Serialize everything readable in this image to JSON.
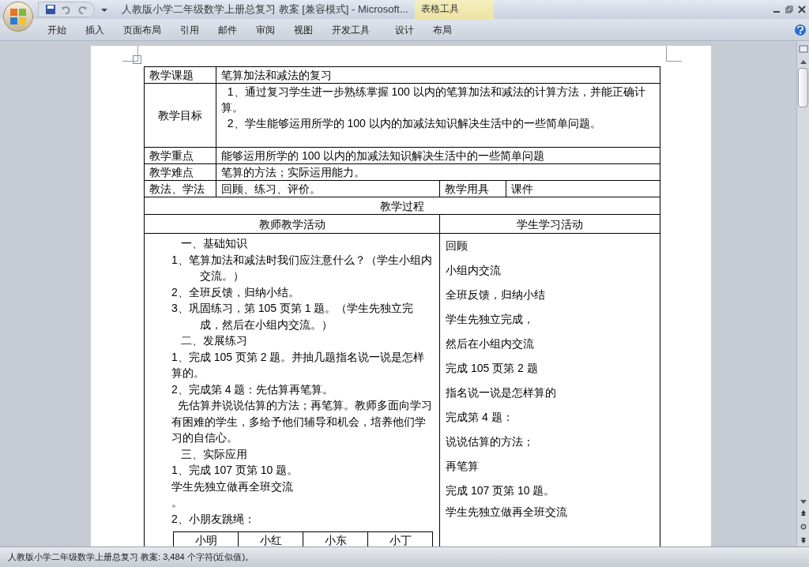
{
  "window": {
    "title": "人教版小学二年级数学上册总复习 教案 [兼容模式] - Microsoft...",
    "context_tab": "表格工具"
  },
  "ribbon_tabs": [
    {
      "label": "开始",
      "selected": false
    },
    {
      "label": "插入",
      "selected": false
    },
    {
      "label": "页面布局",
      "selected": false
    },
    {
      "label": "引用",
      "selected": false
    },
    {
      "label": "邮件",
      "selected": false
    },
    {
      "label": "审阅",
      "selected": false
    },
    {
      "label": "视图",
      "selected": false
    },
    {
      "label": "开发工具",
      "selected": false
    },
    {
      "label": "设计",
      "selected": false
    },
    {
      "label": "布局",
      "selected": false
    }
  ],
  "table": {
    "rows": [
      {
        "label": "教学课题",
        "content": [
          "笔算加法和减法的复习"
        ]
      },
      {
        "label": "教学目标",
        "content": [
          "  1、通过复习学生进一步熟练掌握 100 以内的笔算加法和减法的计算方法，并能正确计算。",
          "  2、学生能够运用所学的 100 以内的加减法知识解决生活中的一些简单问题。"
        ]
      },
      {
        "label": "教学重点",
        "content": [
          "能够运用所学的 100 以内的加减法知识解决生活中的一些简单问题"
        ]
      },
      {
        "label": "教学难点",
        "content": [
          "笔算的方法；实际运用能力。"
        ]
      }
    ],
    "methods": {
      "label": "教法、学法",
      "value": "回顾、练习、评价。",
      "tools_label": "教学用具",
      "tools_value": "课件"
    },
    "process_title": "教学过程",
    "columns": [
      "教师教学活动",
      "学生学习活动"
    ],
    "teacher": [
      {
        "kind": "heading",
        "text": "一、基础知识"
      },
      {
        "kind": "item",
        "text": "1、笔算加法和减法时我们应注意什么？（学生小组内交流。）"
      },
      {
        "kind": "item",
        "text": "2、全班反馈，归纳小结。"
      },
      {
        "kind": "item",
        "text": "3、巩固练习，第 105 页第 1 题。（学生先独立完成，然后在小组内交流。）"
      },
      {
        "kind": "heading",
        "text": "二、发展练习"
      },
      {
        "kind": "plain",
        "text": "1、完成 105 页第 2 题。并抽几题指名说一说是怎样算的。"
      },
      {
        "kind": "plain",
        "text": "2、完成第 4 题：先估算再笔算。"
      },
      {
        "kind": "plain",
        "text": "  先估算并说说估算的方法；再笔算。教师多面向学习有困难的学生，多给予他们辅导和机会，培养他们学习的自信心。"
      },
      {
        "kind": "heading",
        "text": "三、实际应用"
      },
      {
        "kind": "plain",
        "text": "1、完成 107 页第 10 题。"
      },
      {
        "kind": "plain",
        "text": "学生先独立做再全班交流"
      },
      {
        "kind": "plain",
        "text": "。"
      },
      {
        "kind": "plain",
        "text": "2、小朋友跳绳："
      }
    ],
    "rope_table": [
      "小明",
      "小红",
      "小东",
      "小丁"
    ],
    "student": [
      "回顾",
      "小组内交流",
      "全班反馈，归纳小结",
      "学生先独立完成，",
      "然后在小组内交流",
      "完成 105 页第 2 题",
      "指名说一说是怎样算的",
      "完成第 4 题：",
      "说说估算的方法；",
      "再笔算",
      "完成 107 页第 10 题。",
      "学生先独立做再全班交流"
    ]
  },
  "status_bar": "人教版小学二年级数学上册总复习 教案: 3,484 个字符(近似值)。"
}
